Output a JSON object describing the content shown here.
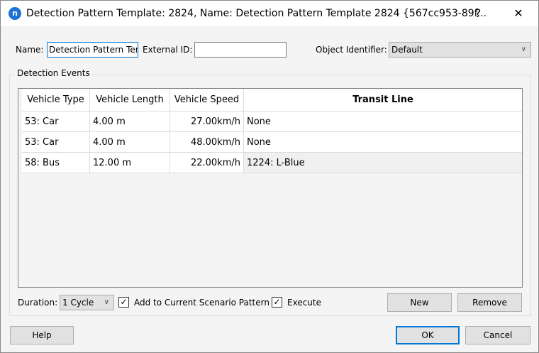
{
  "window": {
    "title": "Detection Pattern Template: 2824, Name: Detection Pattern Template 2824  {567cc953-89f...",
    "help_glyph": "?",
    "close_glyph": "✕",
    "app_icon": "n"
  },
  "form": {
    "name_label": "Name:",
    "name_value": "Detection Pattern Tem",
    "external_id_label": "External ID:",
    "external_id_value": "",
    "object_identifier_label": "Object Identifier:",
    "object_identifier_value": "Default"
  },
  "events": {
    "group_label": "Detection Events",
    "columns": [
      "Vehicle Type",
      "Vehicle Length",
      "Vehicle Speed",
      "Transit Line"
    ],
    "rows": [
      [
        "53: Car",
        "4.00 m",
        "27.00km/h",
        "None"
      ],
      [
        "53: Car",
        "4.00 m",
        "48.00km/h",
        "None"
      ],
      [
        "58: Bus",
        "12.00 m",
        "22.00km/h",
        "1224: L-Blue"
      ]
    ]
  },
  "bottom": {
    "duration_label": "Duration:",
    "duration_value": "1 Cycle",
    "add_to_scenario_label": "Add to Current Scenario Pattern",
    "add_to_scenario_checked": true,
    "execute_label": "Execute",
    "execute_checked": true,
    "new_label": "New",
    "remove_label": "Remove"
  },
  "footer": {
    "help_label": "Help",
    "ok_label": "OK",
    "cancel_label": "Cancel"
  },
  "colors": {
    "accent": "#1e73d8",
    "ok_border": "#0078d7"
  }
}
